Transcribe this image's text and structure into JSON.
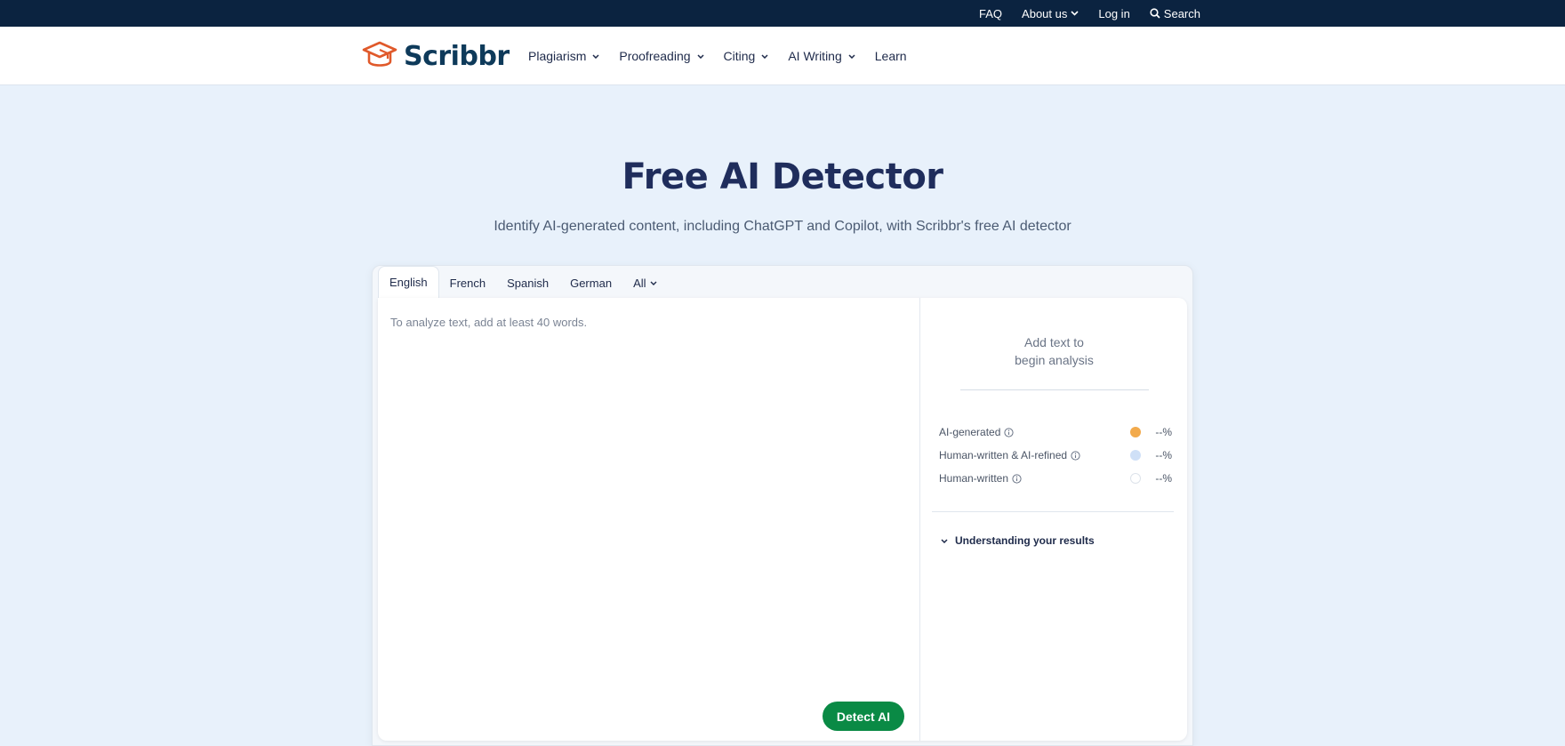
{
  "topbar": {
    "faq": "FAQ",
    "about": "About us",
    "login": "Log in",
    "search": "Search"
  },
  "nav": {
    "logo_text": "Scribbr",
    "items": [
      {
        "label": "Plagiarism",
        "has_dropdown": true
      },
      {
        "label": "Proofreading",
        "has_dropdown": true
      },
      {
        "label": "Citing",
        "has_dropdown": true
      },
      {
        "label": "AI Writing",
        "has_dropdown": true
      },
      {
        "label": "Learn",
        "has_dropdown": false
      }
    ]
  },
  "hero": {
    "title": "Free AI Detector",
    "subtitle": "Identify AI-generated content, including ChatGPT and Copilot, with Scribbr's free AI detector"
  },
  "tool": {
    "tabs": [
      {
        "label": "English",
        "active": true
      },
      {
        "label": "French",
        "active": false
      },
      {
        "label": "Spanish",
        "active": false
      },
      {
        "label": "German",
        "active": false
      },
      {
        "label": "All",
        "active": false
      }
    ],
    "editor_placeholder": "To analyze text, add at least 40 words.",
    "detect_button": "Detect AI",
    "results": {
      "empty_line1": "Add text to",
      "empty_line2": "begin analysis",
      "legend": [
        {
          "label": "AI-generated",
          "value": "--%",
          "color": "#f2aa4c"
        },
        {
          "label": "Human-written & AI-refined",
          "value": "--%",
          "color": "#cfe0f7"
        },
        {
          "label": "Human-written",
          "value": "--%",
          "color": "#ffffff"
        }
      ],
      "understanding_label": "Understanding your results"
    }
  },
  "colors": {
    "topbar_bg": "#0b2340",
    "page_bg": "#e8f1fb",
    "brand_orange": "#e0592a",
    "brand_navy": "#0e3a5a",
    "detect_green": "#0a8a45"
  }
}
